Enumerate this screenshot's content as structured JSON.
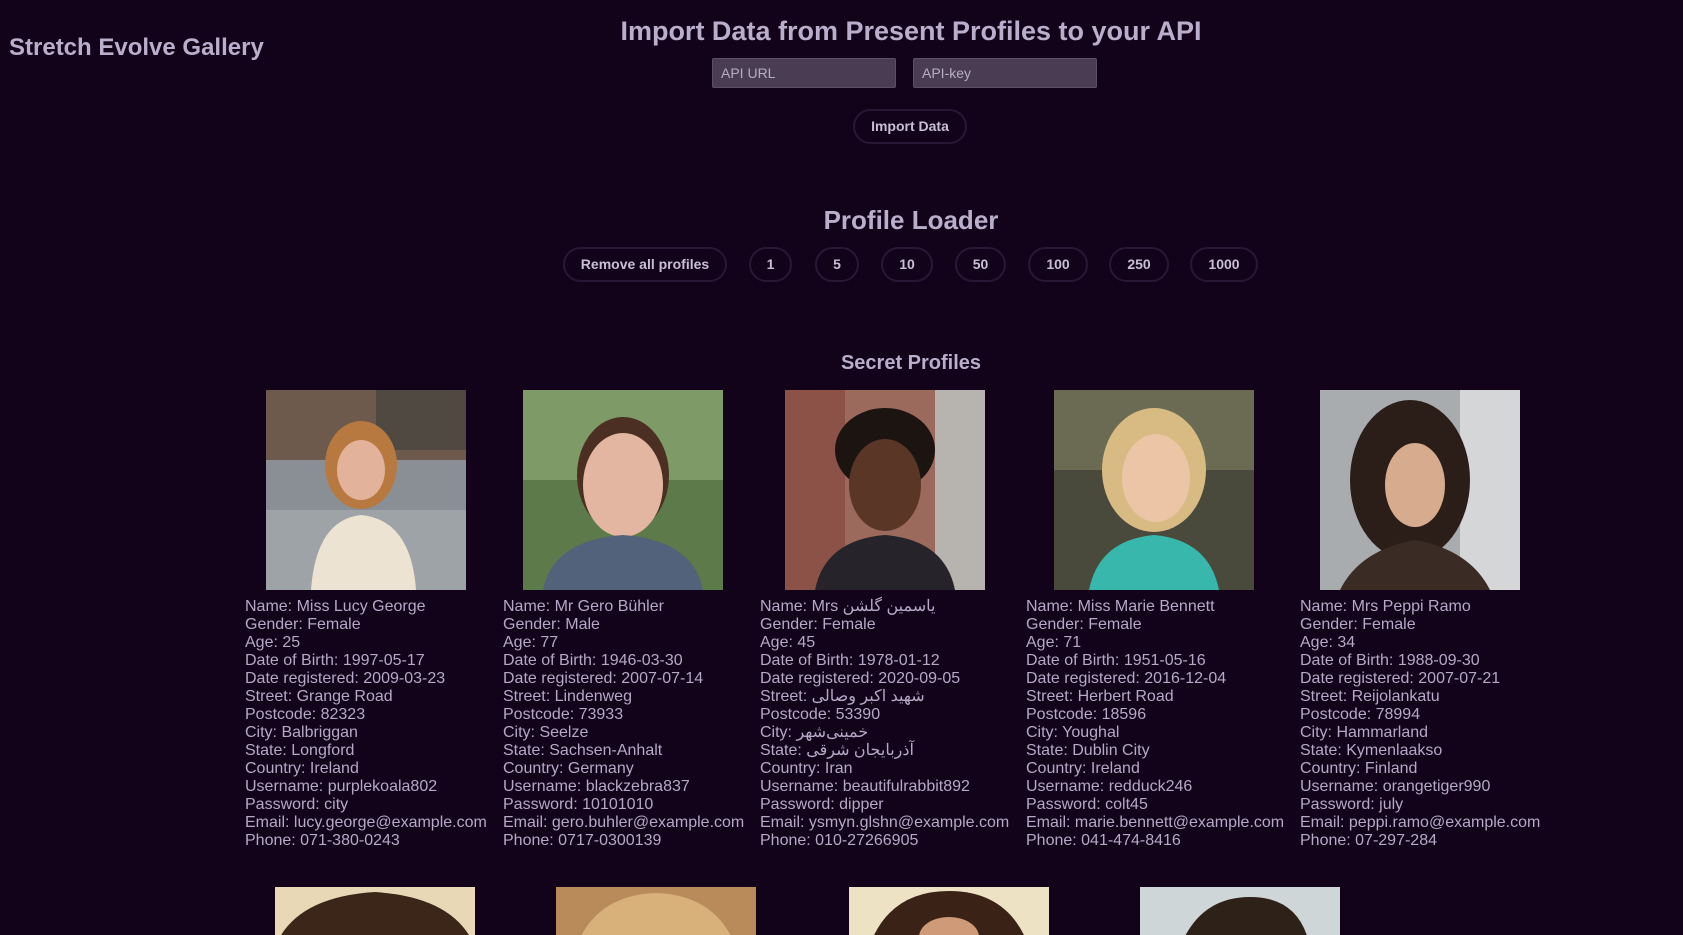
{
  "site": {
    "title": "Stretch Evolve Gallery"
  },
  "import": {
    "heading": "Import Data from Present Profiles to your API",
    "api_url_placeholder": "API URL",
    "api_key_placeholder": "API-key",
    "button_label": "Import Data"
  },
  "loader": {
    "heading": "Profile Loader",
    "remove_label": "Remove all profiles",
    "counts": [
      "1",
      "5",
      "10",
      "50",
      "100",
      "250",
      "1000"
    ]
  },
  "profiles_section": {
    "heading": "Secret Profiles"
  },
  "profiles": [
    {
      "name": "Name: Miss Lucy George",
      "gender": "Gender: Female",
      "age": "Age: 25",
      "dob": "Date of Birth: 1997-05-17",
      "registered": "Date registered: 2009-03-23",
      "street": "Street: Grange Road",
      "postcode": "Postcode: 82323",
      "city": "City: Balbriggan",
      "state": "State: Longford",
      "country": "Country: Ireland",
      "username": "Username: purplekoala802",
      "password": "Password: city",
      "email": "Email: lucy.george@example.com",
      "phone": "Phone: 071-380-0243"
    },
    {
      "name": "Name: Mr Gero Bühler",
      "gender": "Gender: Male",
      "age": "Age: 77",
      "dob": "Date of Birth: 1946-03-30",
      "registered": "Date registered: 2007-07-14",
      "street": "Street: Lindenweg",
      "postcode": "Postcode: 73933",
      "city": "City: Seelze",
      "state": "State: Sachsen-Anhalt",
      "country": "Country: Germany",
      "username": "Username: blackzebra837",
      "password": "Password: 10101010",
      "email": "Email: gero.buhler@example.com",
      "phone": "Phone: 0717-0300139"
    },
    {
      "name": "Name: Mrs یاسمین گلشن",
      "gender": "Gender: Female",
      "age": "Age: 45",
      "dob": "Date of Birth: 1978-01-12",
      "registered": "Date registered: 2020-09-05",
      "street": "Street: شهید اکبر وصالی",
      "postcode": "Postcode: 53390",
      "city": "City: خمینی‌شهر",
      "state": "State: آذربایجان شرقی",
      "country": "Country: Iran",
      "username": "Username: beautifulrabbit892",
      "password": "Password: dipper",
      "email": "Email: ysmyn.glshn@example.com",
      "phone": "Phone: 010-27266905"
    },
    {
      "name": "Name: Miss Marie Bennett",
      "gender": "Gender: Female",
      "age": "Age: 71",
      "dob": "Date of Birth: 1951-05-16",
      "registered": "Date registered: 2016-12-04",
      "street": "Street: Herbert Road",
      "postcode": "Postcode: 18596",
      "city": "City: Youghal",
      "state": "State: Dublin City",
      "country": "Country: Ireland",
      "username": "Username: redduck246",
      "password": "Password: colt45",
      "email": "Email: marie.bennett@example.com",
      "phone": "Phone: 041-474-8416"
    },
    {
      "name": "Name: Mrs Peppi Ramo",
      "gender": "Gender: Female",
      "age": "Age: 34",
      "dob": "Date of Birth: 1988-09-30",
      "registered": "Date registered: 2007-07-21",
      "street": "Street: Reijolankatu",
      "postcode": "Postcode: 78994",
      "city": "City: Hammarland",
      "state": "State: Kymenlaakso",
      "country": "Country: Finland",
      "username": "Username: orangetiger990",
      "password": "Password: july",
      "email": "Email: peppi.ramo@example.com",
      "phone": "Phone: 07-297-284"
    }
  ],
  "colors": {
    "background": "#13031a",
    "text": "#b5a9c7",
    "input_bg": "#4a3d53",
    "button_border": "#2a1736"
  }
}
